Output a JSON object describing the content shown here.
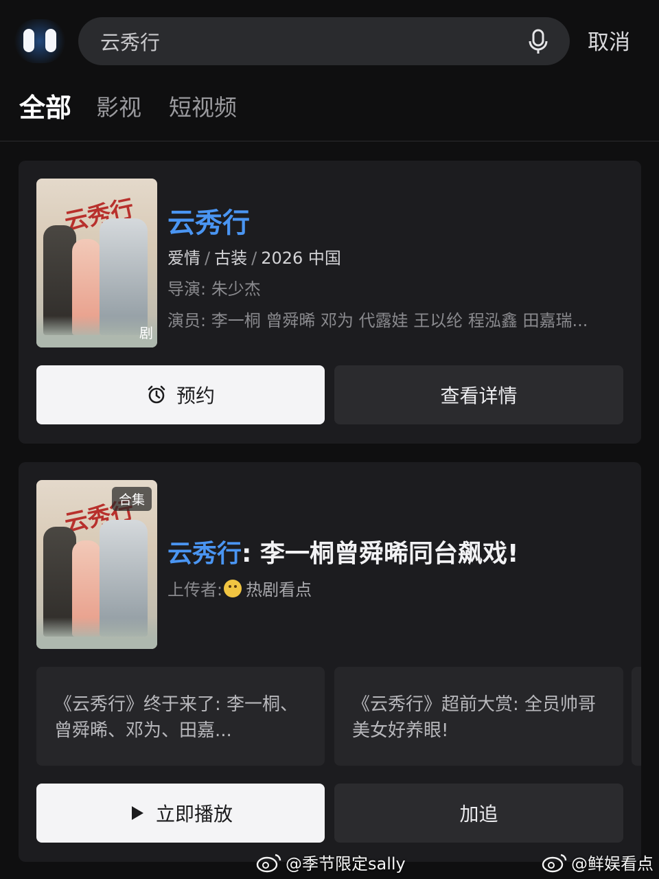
{
  "search": {
    "query": "云秀行",
    "cancel_label": "取消"
  },
  "tabs": [
    {
      "label": "全部",
      "active": true
    },
    {
      "label": "影视",
      "active": false
    },
    {
      "label": "短视频",
      "active": false
    }
  ],
  "drama_card": {
    "title": "云秀行",
    "genre1": "爱情",
    "genre2": "古装",
    "year_region": "2026 中国",
    "director_label": "导演:",
    "director": "朱少杰",
    "cast_label": "演员:",
    "cast": "李一桐 曾舜晞 邓为 代露娃 王以纶 程泓鑫 田嘉瑞...",
    "poster_title": "云秀行",
    "poster_badge": "剧",
    "reserve_button": "预约",
    "details_button": "查看详情"
  },
  "video_card": {
    "poster_title": "云秀行",
    "poster_badge": "合集",
    "title_highlight": "云秀行",
    "title_rest": ": 李一桐曾舜晞同台飙戏!",
    "uploader_label": "上传者:",
    "uploader_name": "热剧看点",
    "clips": [
      "《云秀行》终于来了: 李一桐、曾舜晞、邓为、田嘉...",
      "《云秀行》超前大赏: 全员帅哥美女好养眼!"
    ],
    "play_button": "立即播放",
    "follow_button": "加追"
  },
  "watermarks": [
    "@季节限定sally",
    "@鲜娱看点"
  ],
  "colors": {
    "accent": "#4a95f2",
    "background": "#0f0f10",
    "card": "#1c1c1f"
  },
  "icons": [
    "app-logo-icon",
    "microphone-icon",
    "alarm-clock-icon",
    "play-icon",
    "weibo-icon",
    "uploader-avatar-icon"
  ]
}
